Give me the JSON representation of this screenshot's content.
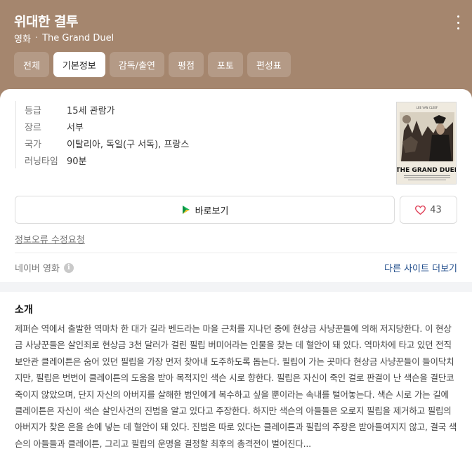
{
  "header": {
    "title": "위대한 결투",
    "category": "영화",
    "original_title": "The Grand Duel",
    "dot": "·",
    "background_color": "#a5866e"
  },
  "tabs": [
    {
      "label": "전체",
      "active": false
    },
    {
      "label": "기본정보",
      "active": true
    },
    {
      "label": "감독/출연",
      "active": false
    },
    {
      "label": "평점",
      "active": false
    },
    {
      "label": "포토",
      "active": false
    },
    {
      "label": "편성표",
      "active": false
    }
  ],
  "info": [
    {
      "key": "등급",
      "value": "15세 관람가"
    },
    {
      "key": "장르",
      "value": "서부"
    },
    {
      "key": "국가",
      "value": "이탈리아, 독일(구 서독), 프랑스"
    },
    {
      "key": "러닝타임",
      "value": "90분"
    }
  ],
  "poster": {
    "top_credit": "LEE VAN CLEEF",
    "title": "THE GRAND DUEL",
    "icon": "poster-image"
  },
  "actions": {
    "watch_label": "바로보기",
    "watch_icon": "play-icon",
    "like_count": "43",
    "like_icon": "heart-icon",
    "like_color": "#e0435a"
  },
  "error_report": "정보오류 수정요청",
  "source": {
    "label": "네이버 영화",
    "info_icon": "i",
    "more_link": "다른 사이트 더보기"
  },
  "intro": {
    "title": "소개",
    "text": "제퍼슨 역에서 출발한 역마차 한 대가 길라 벤드라는 마을 근처를 지나던 중에 현상금 사냥꾼들에 의해 저지당한다. 이 현상금 사냥꾼들은 살인죄로 현상금 3천 달러가 걸린 필립 버미어라는 인물을 찾는 데 혈안이 돼 있다. 역마차에 타고 있던 전직 보안관 클레이튼은 숨어 있던 필립을 가장 먼저 찾아내 도주하도록 돕는다. 필립이 가는 곳마다 현상금 사냥꾼들이 들이닥치지만, 필립은 번번이 클레이튼의 도움을 받아 목적지인 색슨 시로 향한다. 필립은 자신이 죽인 걸로 판결이 난 색슨을 결단코 죽이지 않았으며, 단지 자신의 아버지를 살해한 범인에게 복수하고 싶을 뿐이라는 속내를 털어놓는다. 색슨 시로 가는 길에 클레이튼은 자신이 색슨 살인사건의 진범을 알고 있다고 주장한다. 하지만 색슨의 아들들은 오로지 필립을 제거하고 필립의 아버지가 찾은 은을 손에 넣는 데 혈안이 돼 있다. 진범은 따로 있다는 클레이튼과 필립의 주장은 받아들여지지 않고, 결국 색슨의 아들들과 클레이튼, 그리고 필립의 운명을 결정할 최후의 총격전이 벌어진다..."
  }
}
